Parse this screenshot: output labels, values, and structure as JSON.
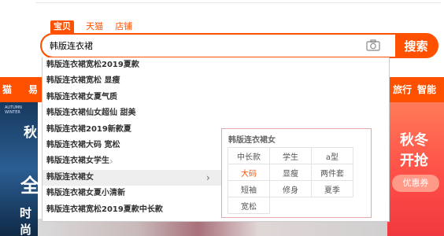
{
  "search": {
    "tabs": [
      {
        "label": "宝贝",
        "active": true
      },
      {
        "label": "天猫",
        "active": false
      },
      {
        "label": "店铺",
        "active": false
      }
    ],
    "query": "韩版连衣裙",
    "button_label": "搜索",
    "camera_icon": "camera-icon"
  },
  "suggestions": [
    {
      "text": "韩版连衣裙宽松2019夏款",
      "has_arrow": false
    },
    {
      "text": "韩版连衣裙宽松 显瘦",
      "has_arrow": false
    },
    {
      "text": "韩版连衣裙女夏气质",
      "has_arrow": false
    },
    {
      "text": "韩版连衣裙仙女超仙 甜美",
      "has_arrow": false
    },
    {
      "text": "韩版连衣裙2019新款夏",
      "has_arrow": false
    },
    {
      "text": "韩版连衣裙大码 宽松",
      "has_arrow": false
    },
    {
      "text": "韩版连衣裙女学生",
      "has_arrow": true
    },
    {
      "text": "韩版连衣裙女",
      "has_arrow": true,
      "active": true
    },
    {
      "text": "韩版连衣裙女夏小清新",
      "has_arrow": false
    },
    {
      "text": "韩版连衣裙宽松2019夏款中长款",
      "has_arrow": false
    }
  ],
  "attribute_panel": {
    "title": "韩版连衣裙女",
    "rows": [
      [
        "中长款",
        "学生",
        "a型"
      ],
      [
        "大码",
        "显瘦",
        "两件套"
      ],
      [
        "短袖",
        "修身",
        "夏季"
      ],
      [
        "宽松",
        "",
        ""
      ]
    ],
    "highlighted": "大码"
  },
  "background": {
    "category_bar": {
      "left_text": "猫",
      "left_text2": "易",
      "right_items": [
        "旅行",
        "智能"
      ]
    },
    "left_banner": {
      "small_text": "AUTUMN WINTER",
      "text1": "秋",
      "text2": "全",
      "text3": "时尚"
    },
    "right_banner": {
      "line1": "秋冬",
      "line2": "开抢",
      "pill": "优惠券"
    }
  },
  "colors": {
    "accent": "#ff5000",
    "panel_border": "#e4a6a6"
  }
}
